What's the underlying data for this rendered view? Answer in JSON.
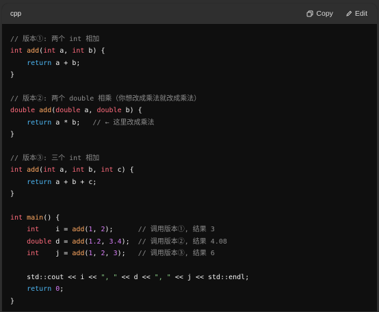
{
  "header": {
    "language": "cpp",
    "copy_label": "Copy",
    "edit_label": "Edit",
    "copy_icon": "copy-icon",
    "edit_icon": "pencil-icon"
  },
  "colors": {
    "background": "#0f0f0f",
    "header": "#2f2f2f",
    "keyword": "#ff6b7c",
    "function": "#ffa861",
    "number": "#d57df5",
    "return": "#4cb4f0",
    "string": "#8fd58c",
    "comment": "#8c8c8c"
  },
  "code_lines": [
    [
      [
        "cm",
        "// 版本①: 两个 int 相加"
      ]
    ],
    [
      [
        "kw",
        "int"
      ],
      [
        "id",
        " "
      ],
      [
        "fn",
        "add"
      ],
      [
        "id",
        "("
      ],
      [
        "kw",
        "int"
      ],
      [
        "id",
        " a, "
      ],
      [
        "kw",
        "int"
      ],
      [
        "id",
        " b) {"
      ]
    ],
    [
      [
        "id",
        "    "
      ],
      [
        "ret",
        "return"
      ],
      [
        "id",
        " a + b;"
      ]
    ],
    [
      [
        "id",
        "}"
      ]
    ],
    [
      [
        "id",
        ""
      ]
    ],
    [
      [
        "cm",
        "// 版本②: 两个 double 相乘（你想改成乘法就改成乘法）"
      ]
    ],
    [
      [
        "kw",
        "double"
      ],
      [
        "id",
        " "
      ],
      [
        "fn",
        "add"
      ],
      [
        "id",
        "("
      ],
      [
        "kw",
        "double"
      ],
      [
        "id",
        " a, "
      ],
      [
        "kw",
        "double"
      ],
      [
        "id",
        " b) {"
      ]
    ],
    [
      [
        "id",
        "    "
      ],
      [
        "ret",
        "return"
      ],
      [
        "id",
        " a * b;   "
      ],
      [
        "cm",
        "// ← 这里改成乘法"
      ]
    ],
    [
      [
        "id",
        "}"
      ]
    ],
    [
      [
        "id",
        ""
      ]
    ],
    [
      [
        "cm",
        "// 版本③: 三个 int 相加"
      ]
    ],
    [
      [
        "kw",
        "int"
      ],
      [
        "id",
        " "
      ],
      [
        "fn",
        "add"
      ],
      [
        "id",
        "("
      ],
      [
        "kw",
        "int"
      ],
      [
        "id",
        " a, "
      ],
      [
        "kw",
        "int"
      ],
      [
        "id",
        " b, "
      ],
      [
        "kw",
        "int"
      ],
      [
        "id",
        " c) {"
      ]
    ],
    [
      [
        "id",
        "    "
      ],
      [
        "ret",
        "return"
      ],
      [
        "id",
        " a + b + c;"
      ]
    ],
    [
      [
        "id",
        "}"
      ]
    ],
    [
      [
        "id",
        ""
      ]
    ],
    [
      [
        "kw",
        "int"
      ],
      [
        "id",
        " "
      ],
      [
        "fn",
        "main"
      ],
      [
        "id",
        "() {"
      ]
    ],
    [
      [
        "id",
        "    "
      ],
      [
        "kw",
        "int"
      ],
      [
        "id",
        "    i = "
      ],
      [
        "fn",
        "add"
      ],
      [
        "id",
        "("
      ],
      [
        "num",
        "1"
      ],
      [
        "id",
        ", "
      ],
      [
        "num",
        "2"
      ],
      [
        "id",
        ");      "
      ],
      [
        "cm",
        "// 调用版本①, 结果 3"
      ]
    ],
    [
      [
        "id",
        "    "
      ],
      [
        "kw",
        "double"
      ],
      [
        "id",
        " d = "
      ],
      [
        "fn",
        "add"
      ],
      [
        "id",
        "("
      ],
      [
        "num",
        "1.2"
      ],
      [
        "id",
        ", "
      ],
      [
        "num",
        "3.4"
      ],
      [
        "id",
        ");  "
      ],
      [
        "cm",
        "// 调用版本②, 结果 4.08"
      ]
    ],
    [
      [
        "id",
        "    "
      ],
      [
        "kw",
        "int"
      ],
      [
        "id",
        "    j = "
      ],
      [
        "fn",
        "add"
      ],
      [
        "id",
        "("
      ],
      [
        "num",
        "1"
      ],
      [
        "id",
        ", "
      ],
      [
        "num",
        "2"
      ],
      [
        "id",
        ", "
      ],
      [
        "num",
        "3"
      ],
      [
        "id",
        ");   "
      ],
      [
        "cm",
        "// 调用版本③, 结果 6"
      ]
    ],
    [
      [
        "id",
        ""
      ]
    ],
    [
      [
        "id",
        "    std::cout << i << "
      ],
      [
        "str",
        "\", \""
      ],
      [
        "id",
        " << d << "
      ],
      [
        "str",
        "\", \""
      ],
      [
        "id",
        " << j << std::endl;"
      ]
    ],
    [
      [
        "id",
        "    "
      ],
      [
        "ret",
        "return"
      ],
      [
        "id",
        " "
      ],
      [
        "num",
        "0"
      ],
      [
        "id",
        ";"
      ]
    ],
    [
      [
        "id",
        "}"
      ]
    ]
  ]
}
